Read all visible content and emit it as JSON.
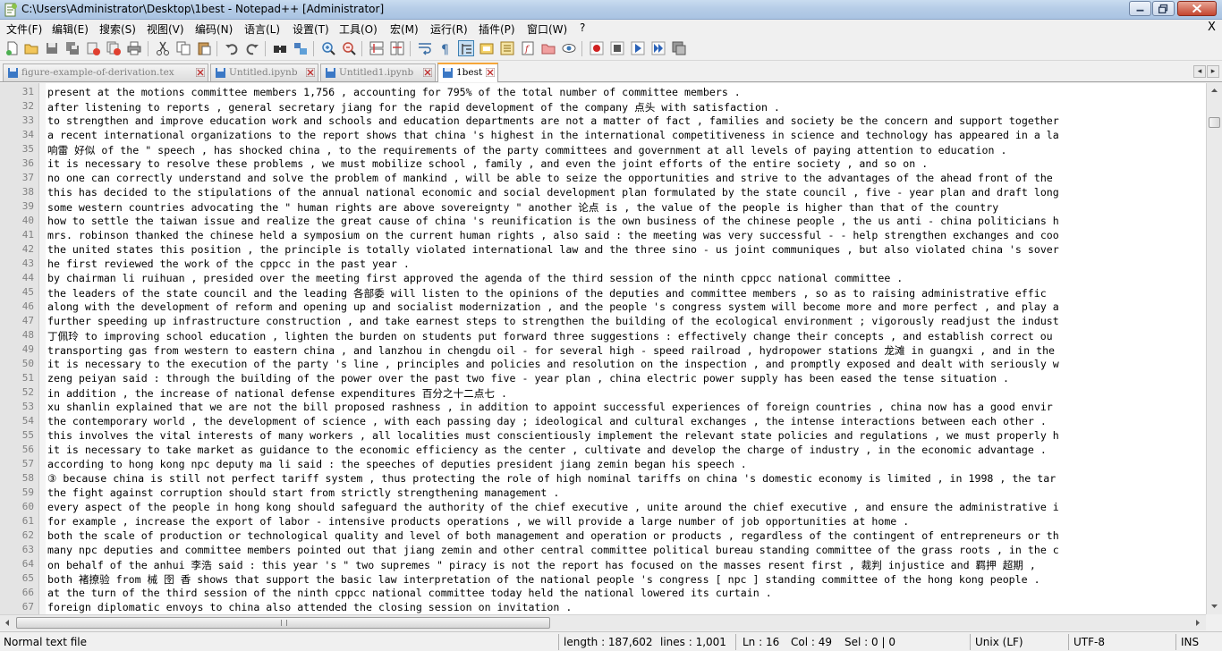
{
  "window": {
    "title": "C:\\Users\\Administrator\\Desktop\\1best - Notepad++ [Administrator]"
  },
  "menu": {
    "items": [
      "文件(F)",
      "编辑(E)",
      "搜索(S)",
      "视图(V)",
      "编码(N)",
      "语言(L)",
      "设置(T)",
      "工具(O)",
      "宏(M)",
      "运行(R)",
      "插件(P)",
      "窗口(W)",
      "?"
    ],
    "close_label": "X"
  },
  "toolbar": {
    "icons": [
      "new-file-icon",
      "open-file-icon",
      "save-icon",
      "save-all-icon",
      "close-icon",
      "close-all-icon",
      "print-icon",
      "cut-icon",
      "copy-icon",
      "paste-icon",
      "undo-icon",
      "redo-icon",
      "find-icon",
      "replace-icon",
      "zoom-in-icon",
      "zoom-out-icon",
      "sync-vertical-icon",
      "sync-horizontal-icon",
      "word-wrap-icon",
      "show-all-chars-icon",
      "indent-guide-icon",
      "language-icon",
      "function-list-icon",
      "document-map-icon",
      "folder-workspace-icon",
      "monitor-icon",
      "record-macro-icon",
      "stop-record-icon",
      "play-macro-icon",
      "run-macro-multiple-icon",
      "save-macro-icon"
    ]
  },
  "tabs": [
    {
      "label": "figure-example-of-derivation.tex",
      "active": false,
      "saved": true
    },
    {
      "label": "Untitled.ipynb",
      "active": false,
      "saved": true
    },
    {
      "label": "Untitled1.ipynb",
      "active": false,
      "saved": true
    },
    {
      "label": "1best",
      "active": true,
      "saved": true
    }
  ],
  "editor": {
    "lines": [
      {
        "num": "31",
        "text": "present at the motions committee members 1,756 , accounting for 795% of the total number of committee members ."
      },
      {
        "num": "32",
        "text": "after listening to reports , general secretary jiang for the rapid development of the company 点头 with satisfaction ."
      },
      {
        "num": "33",
        "text": "to strengthen and improve education work and schools and education departments are not a matter of fact , families and society be the concern and support together"
      },
      {
        "num": "34",
        "text": "a recent international organizations to the report shows that china 's highest in the international competitiveness in science and technology has appeared in a la"
      },
      {
        "num": "35",
        "text": "响雷 好似 of the \" speech , has shocked china , to the requirements of the party committees and government at all levels of paying attention to education ."
      },
      {
        "num": "36",
        "text": "it is necessary to resolve these problems , we must mobilize school , family , and even the joint efforts of the entire society , and so on ."
      },
      {
        "num": "37",
        "text": "no one can correctly understand and solve the problem of mankind , will be able to seize the opportunities and strive to the advantages of the ahead front of the"
      },
      {
        "num": "38",
        "text": "this has decided to the stipulations of the annual national economic and social development plan formulated by the state council , five - year plan and draft long"
      },
      {
        "num": "39",
        "text": "some western countries advocating the \" human rights are above sovereignty \" another 论点 is , the value of the people is higher than that of the country"
      },
      {
        "num": "40",
        "text": "how to settle the taiwan issue and realize the great cause of china 's reunification is the own business of the chinese people , the us anti - china politicians h"
      },
      {
        "num": "41",
        "text": "mrs. robinson thanked the chinese held a symposium on the current human rights , also said : the meeting was very successful - - help strengthen exchanges and coo"
      },
      {
        "num": "42",
        "text": "the united states this position , the principle is totally violated international law and the three sino - us joint communiques , but also violated china 's sover"
      },
      {
        "num": "43",
        "text": "he first reviewed the work of the cppcc in the past year ."
      },
      {
        "num": "44",
        "text": "by chairman li ruihuan , presided over the meeting first approved the agenda of the third session of the ninth cppcc national committee ."
      },
      {
        "num": "45",
        "text": "the leaders of the state council and the leading 各部委 will listen to the opinions of the deputies and committee members , so as to raising administrative effic"
      },
      {
        "num": "46",
        "text": "along with the development of reform and opening up and socialist modernization , and the people 's congress system will become more and more perfect , and play a"
      },
      {
        "num": "47",
        "text": "further speeding up infrastructure construction , and take earnest steps to strengthen the building of the ecological environment ; vigorously readjust the indust"
      },
      {
        "num": "48",
        "text": "丁佩玲 to improving school education , lighten the burden on students put forward three suggestions : effectively change their concepts , and establish correct ou"
      },
      {
        "num": "49",
        "text": "transporting gas from western to eastern china , and lanzhou in chengdu oil - for several high - speed railroad , hydropower stations 龙滩 in guangxi , and in the"
      },
      {
        "num": "50",
        "text": "it is necessary to the execution of the party 's line , principles and policies and resolution on the inspection , and promptly exposed and dealt with seriously w"
      },
      {
        "num": "51",
        "text": "zeng peiyan said : through the building of the power over the past two five - year plan , china electric power supply has been eased the tense situation ."
      },
      {
        "num": "52",
        "text": "in addition , the increase of national defense expenditures 百分之十二点七 ."
      },
      {
        "num": "53",
        "text": "xu shanlin explained that we are not the bill proposed rashness , in addition to appoint successful experiences of foreign countries , china now has a good envir"
      },
      {
        "num": "54",
        "text": "the contemporary world , the development of science , with each passing day ; ideological and cultural exchanges , the intense interactions between each other ."
      },
      {
        "num": "55",
        "text": "this involves the vital interests of many workers , all localities must conscientiously implement the relevant state policies and regulations , we must properly h"
      },
      {
        "num": "56",
        "text": "it is necessary to take market as guidance to the economic efficiency as the center , cultivate and develop the charge of industry , in the economic advantage ."
      },
      {
        "num": "57",
        "text": "according to hong kong npc deputy ma li said : the speeches of deputies president jiang zemin began his speech ."
      },
      {
        "num": "58",
        "text": "③ because china is still not perfect tariff system , thus protecting the role of high nominal tariffs on china 's domestic economy is limited , in 1998 , the tar"
      },
      {
        "num": "59",
        "text": "the fight against corruption should start from strictly strengthening management ."
      },
      {
        "num": "60",
        "text": "every aspect of the people in hong kong should safeguard the authority of the chief executive , unite around the chief executive , and ensure the administrative i"
      },
      {
        "num": "61",
        "text": "for example , increase the export of labor - intensive products operations , we will provide a large number of job opportunities at home ."
      },
      {
        "num": "62",
        "text": "both the scale of production or technological quality and level of both management and operation or products , regardless of the contingent of entrepreneurs or th"
      },
      {
        "num": "63",
        "text": "many npc deputies and committee members pointed out that jiang zemin and other central committee political bureau standing committee of the grass roots , in the c"
      },
      {
        "num": "64",
        "text": "on behalf of the anhui 李浩 said : this year 's \" two supremes \" piracy is not the report has focused on the masses resent first , 裁判 injustice and 羁押 超期 ,"
      },
      {
        "num": "65",
        "text": "both 褚撩验 from 械 囹 香 shows that support the basic law interpretation of the national people 's congress [ npc ] standing committee of the hong kong people ."
      },
      {
        "num": "66",
        "text": "at the turn of the third session of the ninth cppcc national committee today held the national lowered its curtain ."
      },
      {
        "num": "67",
        "text": "foreign diplomatic envoys to china also attended the closing session on invitation ."
      }
    ]
  },
  "statusbar": {
    "file_type": "Normal text file",
    "length": "length : 187,602",
    "lines": "lines : 1,001",
    "ln": "Ln : 16",
    "col": "Col : 49",
    "sel": "Sel : 0 | 0",
    "eol": "Unix (LF)",
    "encoding": "UTF-8",
    "mode": "INS"
  }
}
